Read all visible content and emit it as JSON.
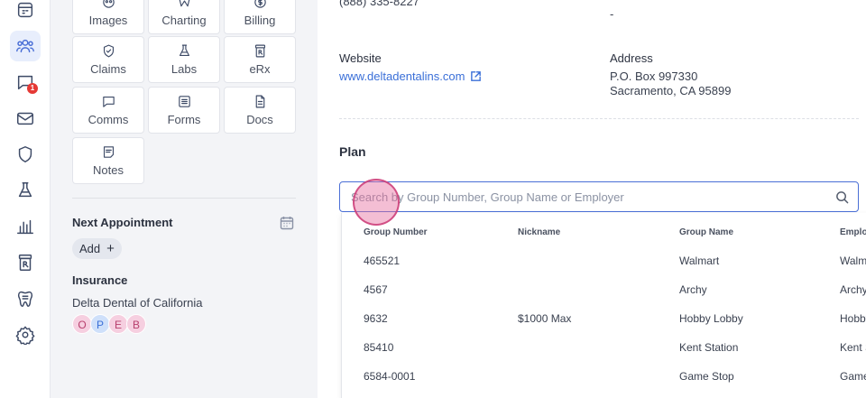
{
  "rail": {
    "items": [
      {
        "name": "schedule-icon"
      },
      {
        "name": "patients-icon"
      },
      {
        "name": "messages-icon",
        "badge": "1"
      },
      {
        "name": "mail-icon"
      },
      {
        "name": "shield-icon"
      },
      {
        "name": "flask-icon"
      },
      {
        "name": "analytics-icon"
      },
      {
        "name": "rx-icon"
      },
      {
        "name": "tooth-icon"
      },
      {
        "name": "settings-icon"
      }
    ]
  },
  "tiles": {
    "images": "Images",
    "charting": "Charting",
    "billing": "Billing",
    "claims": "Claims",
    "labs": "Labs",
    "erx": "eRx",
    "comms": "Comms",
    "forms": "Forms",
    "docs": "Docs",
    "notes": "Notes"
  },
  "next_appointment": {
    "title": "Next Appointment",
    "add_label": "Add"
  },
  "insurance": {
    "title": "Insurance",
    "name": "Delta Dental of California",
    "chips": [
      "O",
      "P",
      "E",
      "B"
    ]
  },
  "contact": {
    "phone": "(888) 335-8227",
    "phone_right": "-",
    "website_label": "Website",
    "website": "www.deltadentalins.com",
    "address_label": "Address",
    "address_line1": "P.O. Box 997330",
    "address_line2": "Sacramento, CA 95899"
  },
  "plan": {
    "title": "Plan",
    "search_placeholder": "Search by Group Number, Group Name or Employer",
    "columns": [
      "Group Number",
      "Nickname",
      "Group Name",
      "Employer"
    ],
    "rows": [
      {
        "group_number": "465521",
        "nickname": "",
        "group_name": "Walmart",
        "employer": "Walmart"
      },
      {
        "group_number": "4567",
        "nickname": "",
        "group_name": "Archy",
        "employer": "Archy"
      },
      {
        "group_number": "9632",
        "nickname": "$1000 Max",
        "group_name": "Hobby Lobby",
        "employer": "Hobby Lobby"
      },
      {
        "group_number": "85410",
        "nickname": "",
        "group_name": "Kent Station",
        "employer": "Kent Station"
      },
      {
        "group_number": "6584-0001",
        "nickname": "",
        "group_name": "Game Stop",
        "employer": "Game Stop"
      }
    ]
  },
  "colors": {
    "accent": "#4a6fd6",
    "link": "#3a6fd8",
    "badge": "#e53935"
  }
}
